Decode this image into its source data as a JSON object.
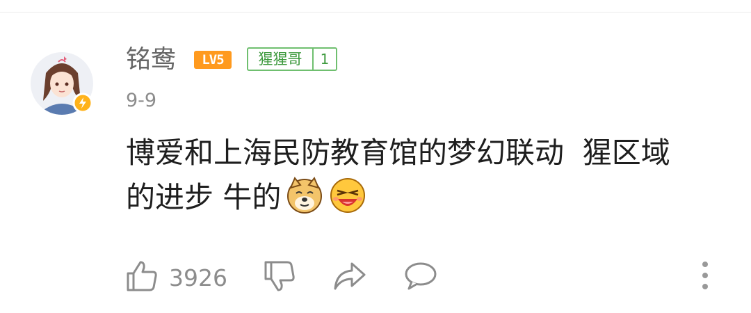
{
  "comment": {
    "username": "铭鸯",
    "level_badge": "LV5",
    "fan_badge": {
      "name": "猩猩哥",
      "level": "1"
    },
    "date": "9-9",
    "text_line1": "博爱和上海民防教育馆的梦幻联动  猩区域",
    "text_line2": "的进步 牛的",
    "emojis": [
      "doge-emoji",
      "laughing-emoji"
    ]
  },
  "actions": {
    "like_count": "3926",
    "icons": [
      "thumbs-up-icon",
      "thumbs-down-icon",
      "share-icon",
      "reply-icon",
      "more-icon"
    ]
  },
  "colors": {
    "level_badge": "#ff9a1e",
    "fan_badge": "#6fbf6f",
    "meta_text": "#8c8c8c"
  }
}
